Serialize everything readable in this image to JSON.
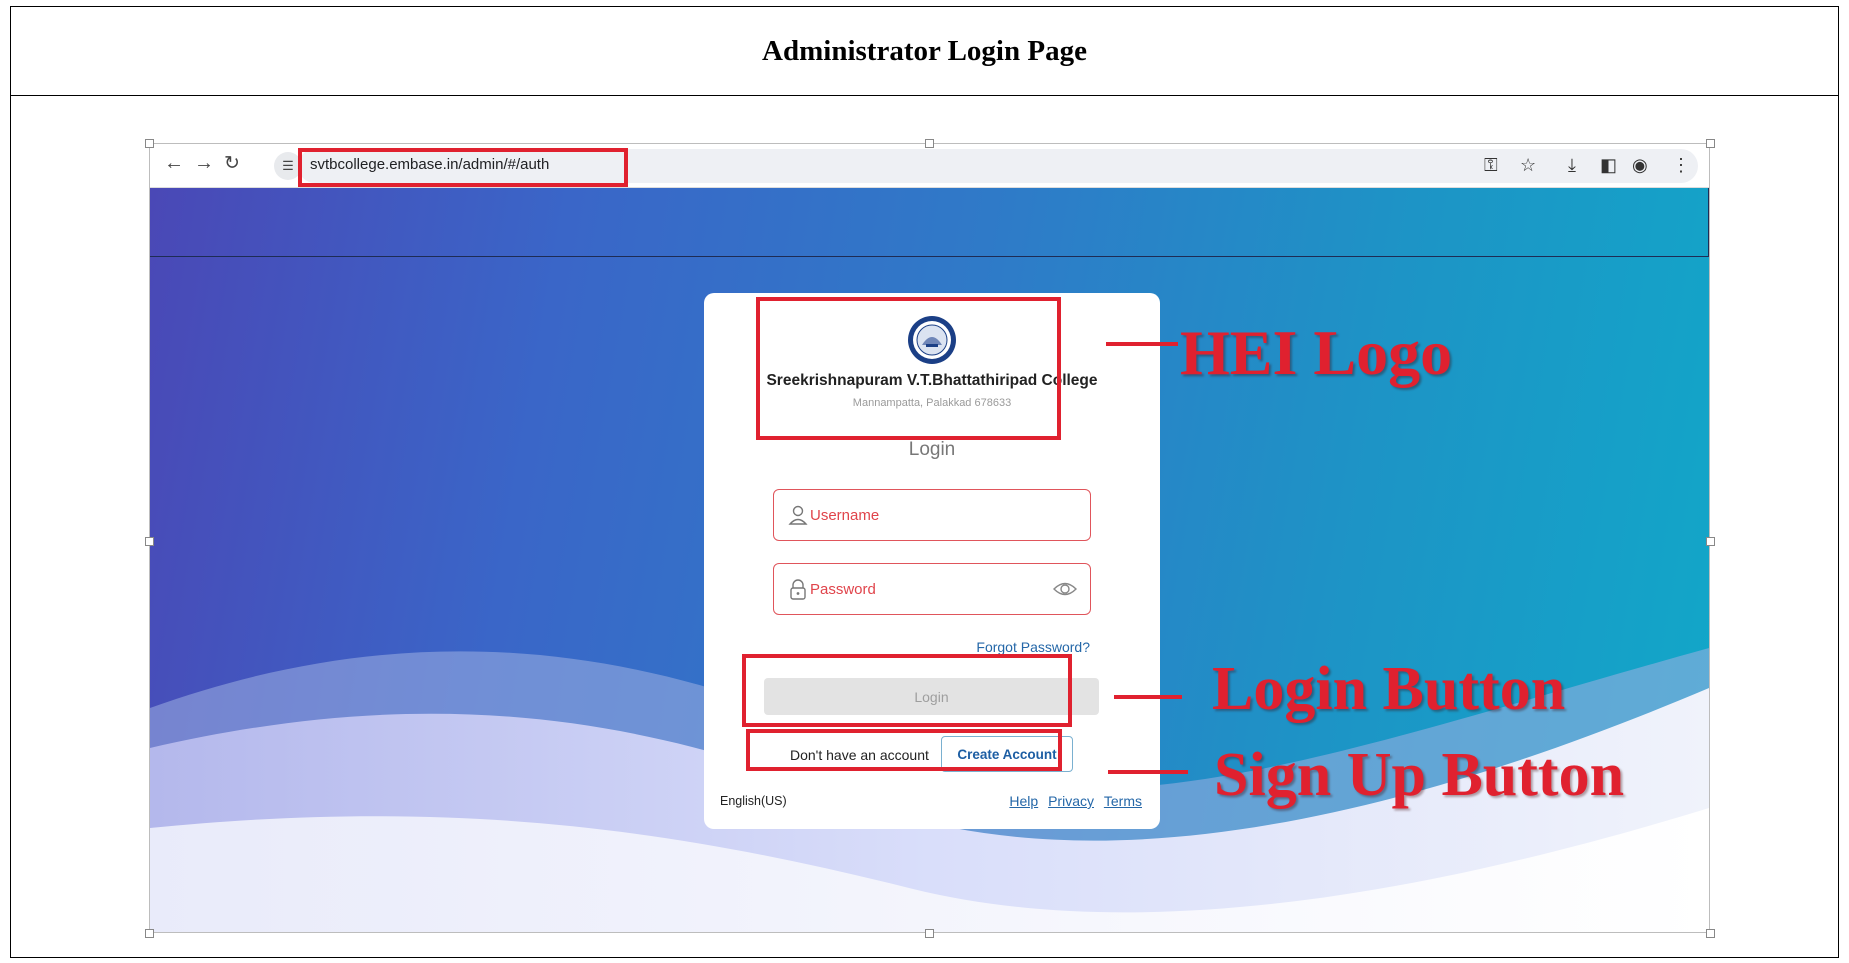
{
  "document": {
    "title": "Administrator Login Page"
  },
  "browser": {
    "url": "svtbcollege.embase.in/admin/#/auth",
    "icons": [
      "back-arrow-icon",
      "forward-arrow-icon",
      "reload-icon",
      "site-settings-icon",
      "password-key-icon",
      "star-icon",
      "download-icon",
      "side-panel-icon",
      "profile-icon",
      "menu-dots-icon"
    ]
  },
  "card": {
    "college_name": "Sreekrishnapuram V.T.Bhattathiripad College",
    "address": "Mannampatta, Palakkad 678633",
    "heading": "Login",
    "username_placeholder": "Username",
    "password_placeholder": "Password",
    "forgot_password": "Forgot Password?",
    "login_button": "Login",
    "no_account_text": "Don't have an account",
    "create_account_button": "Create Account",
    "language": "English(US)",
    "links": {
      "help": "Help",
      "privacy": "Privacy",
      "terms": "Terms"
    }
  },
  "annotations": {
    "logo_label": "HEI Logo",
    "login_label": "Login Button",
    "signup_label": "Sign Up Button"
  },
  "colors": {
    "annotation_red": "#e0212f",
    "field_border": "#e0555b",
    "link_blue": "#2467a8",
    "bg_left": "#4a48b6",
    "bg_right": "#11a8c9"
  }
}
